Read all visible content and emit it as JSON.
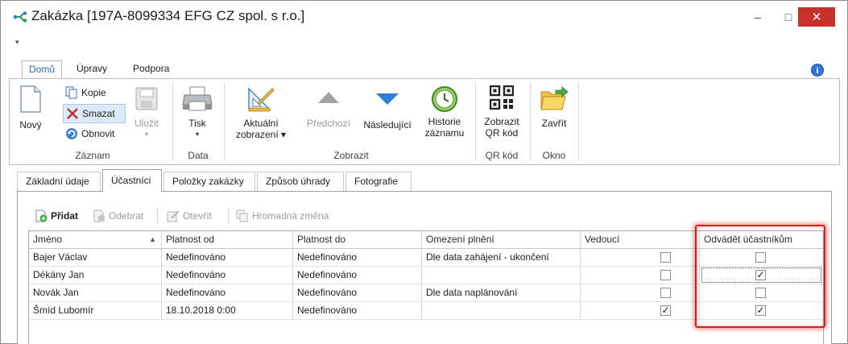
{
  "window": {
    "title": "Zakázka [197A-8099334 EFG CZ spol. s r.o.]",
    "controls": {
      "minimize": "–",
      "maximize": "□",
      "close": "✕"
    }
  },
  "quick_access": {
    "glyph": "▾"
  },
  "ribbon_tabs": [
    "Domů",
    "Úpravy",
    "Podpora"
  ],
  "info": {
    "glyph": "i"
  },
  "ribbon": {
    "zaznam": {
      "label": "Záznam",
      "novy": "Nový",
      "kopie": "Kopie",
      "smazat": "Smazat",
      "obnovit": "Obnovit",
      "ulozit": "Uložit"
    },
    "data": {
      "label": "Data",
      "tisk": "Tisk"
    },
    "zobrazit": {
      "label": "Zobrazit",
      "aktualni_1": "Aktuální",
      "aktualni_2": "zobrazení ▾",
      "predchozi": "Předchozí",
      "nasledujici": "Následující",
      "historie_1": "Historie",
      "historie_2": "záznamu"
    },
    "qr": {
      "label": "QR kód",
      "btn_1": "Zobrazit",
      "btn_2": "QR kód"
    },
    "okno": {
      "label": "Okno",
      "zavrit": "Zavřít"
    }
  },
  "doc_tabs": [
    "Základní údaje",
    "Účastníci",
    "Položky zakázky",
    "Způsob úhrady",
    "Fotografie"
  ],
  "grid_toolbar": {
    "pridat": "Přidat",
    "odebrat": "Odebrat",
    "otevrit": "Otevřít",
    "hromadna": "Hromadná změna"
  },
  "grid": {
    "columns": [
      "Jméno",
      "Platnost od",
      "Platnost do",
      "Omezení plnění",
      "Vedoucí",
      "Odvádět účastníkům"
    ],
    "sort_glyph": "▲",
    "rows": [
      {
        "jmeno": "Bajer Václav",
        "od": "Nedefinováno",
        "do": "Nedefinováno",
        "omezeni": "Dle data zahájení - ukončení",
        "vedouci": false,
        "odvadet": false
      },
      {
        "jmeno": "Dékány Jan",
        "od": "Nedefinováno",
        "do": "Nedefinováno",
        "omezeni": "",
        "vedouci": false,
        "odvadet": true
      },
      {
        "jmeno": "Novák Jan",
        "od": "Nedefinováno",
        "do": "Nedefinováno",
        "omezeni": "Dle data naplánování",
        "vedouci": false,
        "odvadet": false
      },
      {
        "jmeno": "Šmíd Lubomír",
        "od": "18.10.2018 0:00",
        "do": "Nedefinováno",
        "omezeni": "",
        "vedouci": true,
        "odvadet": true
      }
    ],
    "check_glyph": "✓"
  },
  "colors": {
    "accent": "#2a6cc7",
    "highlight": "#e0191b",
    "close": "#c7312b"
  }
}
